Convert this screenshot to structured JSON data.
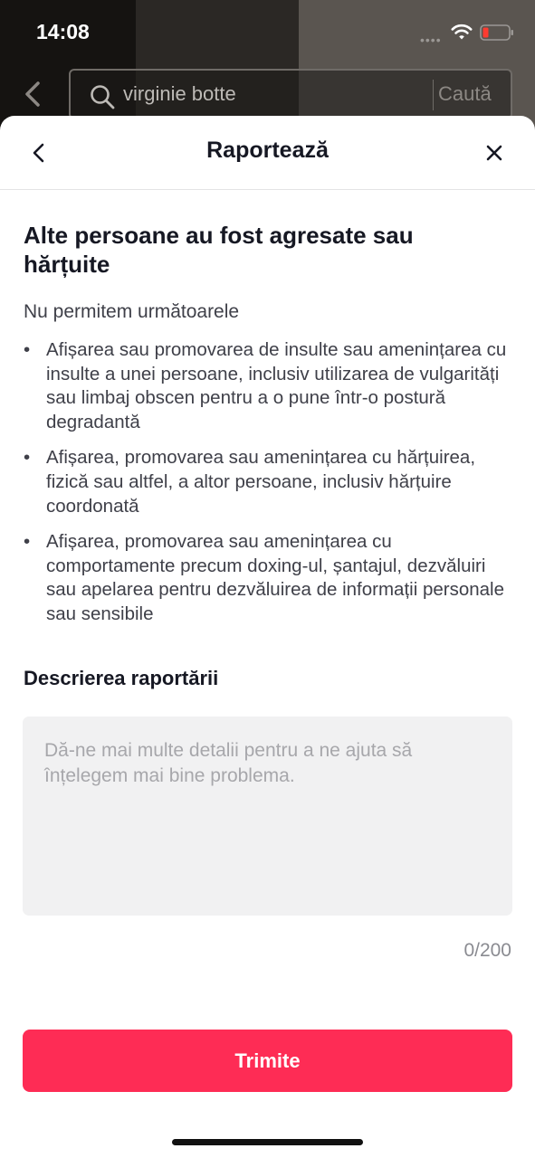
{
  "status_bar": {
    "time": "14:08",
    "signal": "••••"
  },
  "background_app": {
    "search_query": "virginie botte",
    "search_button": "Caută",
    "gray_fill": "#5a5550",
    "dark_fill": "#151311"
  },
  "sheet": {
    "title": "Raportează",
    "heading": "Alte persoane au fost agresate sau hărțuite",
    "intro": "Nu permitem următoarele",
    "rules": [
      "Afișarea sau promovarea de insulte sau amenințarea cu insulte a unei persoane, inclusiv utilizarea de vulgarități sau limbaj obscen pentru a o pune într-o postură degradantă",
      "Afișarea, promovarea sau amenințarea cu hărțuirea, fizică sau altfel, a altor persoane, inclusiv hărțuire coordonată",
      "Afișarea, promovarea sau amenințarea cu comportamente precum doxing-ul, șantajul, dezvăluiri sau apelarea pentru dezvăluirea de informații personale sau sensibile"
    ],
    "bullet": "•",
    "description_label": "Descrierea raportării",
    "description_value": "",
    "description_placeholder": "Dă-ne mai multe detalii pentru a ne ajuta să înțelegem mai bine problema.",
    "counter": "0/200",
    "submit_label": "Trimite"
  },
  "icons": {
    "back": "chevron-left-icon",
    "close": "close-icon",
    "search": "search-icon",
    "wifi": "wifi-icon",
    "battery": "battery-icon"
  },
  "colors": {
    "accent": "#fe2c55",
    "text_primary": "#161823",
    "text_secondary": "#3f4049",
    "input_bg": "#f1f1f2",
    "placeholder": "#a7a7ab",
    "battery_low": "#ff3b30"
  }
}
